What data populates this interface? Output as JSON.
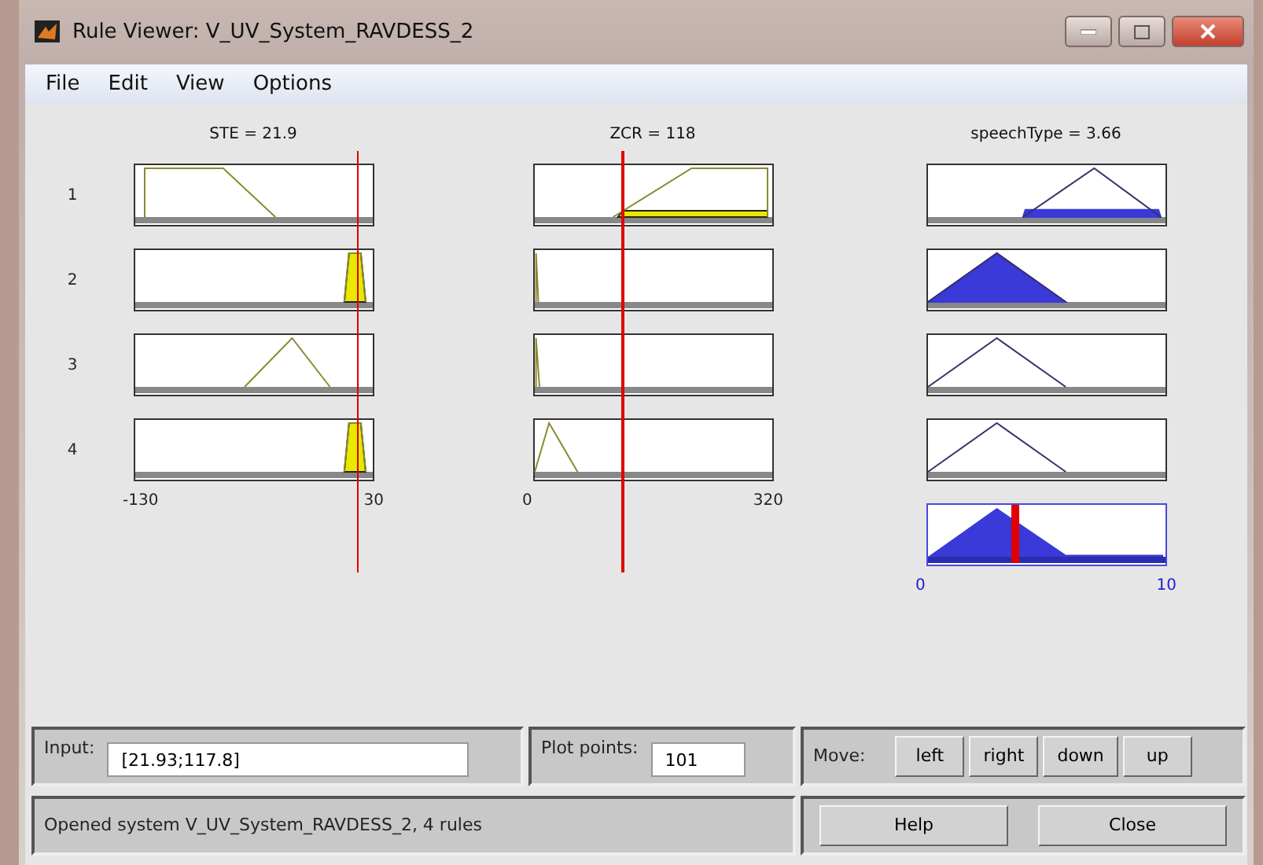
{
  "window": {
    "title": "Rule Viewer: V_UV_System_RAVDESS_2"
  },
  "menu": [
    "File",
    "Edit",
    "View",
    "Options"
  ],
  "inputs": [
    {
      "title": "STE = 21.9",
      "range_min": "-130",
      "range_max": "30"
    },
    {
      "title": "ZCR = 118",
      "range_min": "0",
      "range_max": "320"
    }
  ],
  "output": {
    "title": "speechType = 3.66",
    "range_min": "0",
    "range_max": "10"
  },
  "rules": [
    "1",
    "2",
    "3",
    "4"
  ],
  "input_field": {
    "label": "Input:",
    "value": "[21.93;117.8]"
  },
  "plot_points": {
    "label": "Plot points:",
    "value": "101"
  },
  "move": {
    "label": "Move:",
    "buttons": [
      "left",
      "right",
      "down",
      "up"
    ]
  },
  "status": "Opened system V_UV_System_RAVDESS_2, 4 rules",
  "buttons": [
    "Help",
    "Close"
  ]
}
